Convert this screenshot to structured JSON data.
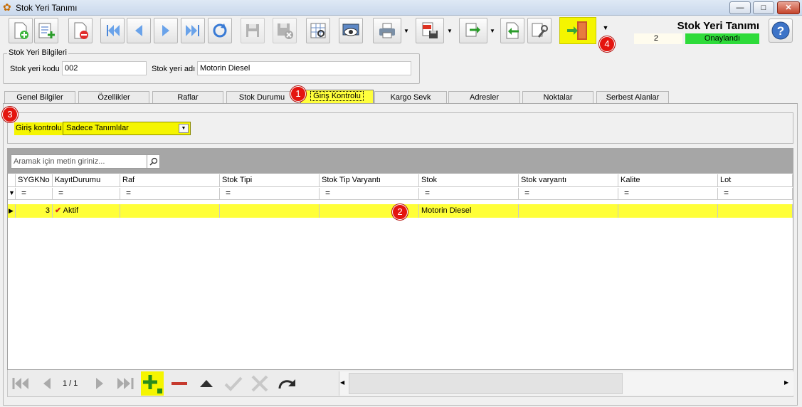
{
  "window": {
    "title": "Stok Yeri Tanımı",
    "minimize": "—",
    "maximize": "□",
    "close": "✕"
  },
  "toolbar": {
    "icons": [
      "new-document-icon",
      "add-list-icon",
      "delete-icon",
      "first-record-icon",
      "previous-record-icon",
      "next-record-icon",
      "last-record-icon",
      "refresh-icon",
      "save-icon",
      "cancel-save-icon",
      "report-preview-icon",
      "view-icon",
      "print-icon",
      "pdf-export-icon",
      "export-icon",
      "import-icon",
      "settings-icon",
      "exit-door-icon",
      "help-icon"
    ]
  },
  "header": {
    "title": "Stok Yeri Tanımı",
    "record_count": "2",
    "status": "Onaylandı",
    "status_color": "#2edb3a"
  },
  "stock_location": {
    "group_title": "Stok Yeri Bilgileri",
    "code_label": "Stok yeri kodu",
    "code_value": "002",
    "name_label": "Stok yeri adı",
    "name_value": "Motorin Diesel"
  },
  "tabs": [
    {
      "label": "Genel Bilgiler"
    },
    {
      "label": "Özellikler"
    },
    {
      "label": "Raflar"
    },
    {
      "label": "Stok Durumu"
    },
    {
      "label": "Giriş Kontrolu",
      "active": true
    },
    {
      "label": "Kargo Sevk"
    },
    {
      "label": "Adresler"
    },
    {
      "label": "Noktalar"
    },
    {
      "label": "Serbest Alanlar"
    }
  ],
  "entry_control": {
    "label": "Giriş kontrolu",
    "selected": "Sadece Tanımlılar"
  },
  "grid": {
    "search_placeholder": "Aramak için metin giriniz...",
    "columns": [
      "SYGKNo",
      "KayıtDurumu",
      "Raf",
      "Stok Tipi",
      "Stok Tip Varyantı",
      "Stok",
      "Stok varyantı",
      "Kalite",
      "Lot"
    ],
    "filter_symbol": "=",
    "rows": [
      {
        "sygkno": "3",
        "status": "Aktif",
        "raf": "",
        "stok_tipi": "",
        "stok_tip_varyanti": "",
        "stok": "Motorin Diesel",
        "stok_varyanti": "",
        "kalite": "",
        "lot": ""
      }
    ]
  },
  "navigator": {
    "page": "1 / 1"
  },
  "highlight_color": "#ffff38",
  "annotations": [
    "1",
    "2",
    "3",
    "4"
  ]
}
